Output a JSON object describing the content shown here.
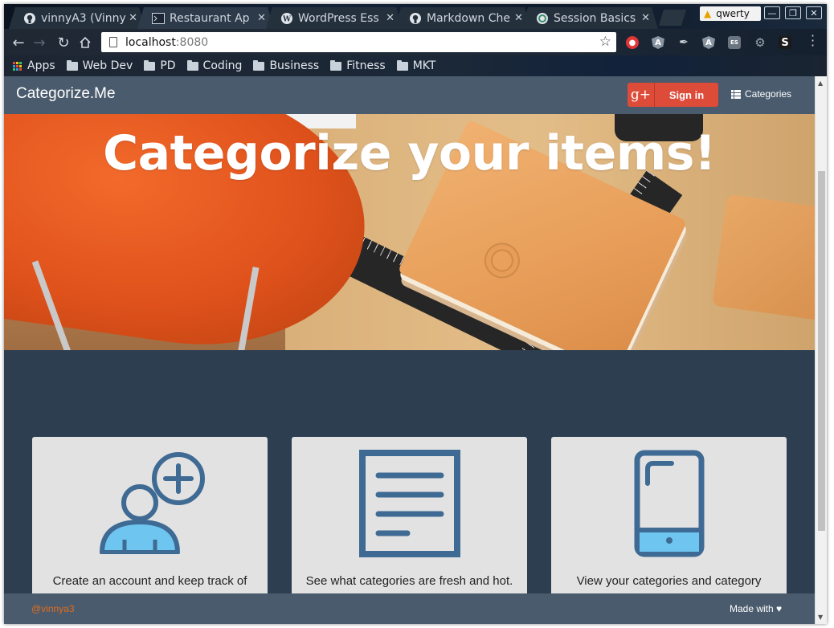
{
  "browser": {
    "tabs": [
      {
        "title": "vinnyA3 (Vinny",
        "icon": "github-icon"
      },
      {
        "title": "Restaurant Ap",
        "icon": "terminal-icon",
        "active": true
      },
      {
        "title": "WordPress Ess",
        "icon": "wordpress-icon"
      },
      {
        "title": "Markdown Che",
        "icon": "github-icon"
      },
      {
        "title": "Session Basics",
        "icon": "session-icon"
      }
    ],
    "profile_name": "qwerty",
    "url_host": "localhost",
    "url_port": ":8080",
    "bookmarks": {
      "apps": "Apps",
      "items": [
        "Web Dev",
        "PD",
        "Coding",
        "Business",
        "Fitness",
        "MKT"
      ]
    },
    "extensions": [
      "shield-ext-icon",
      "angular-ext-icon",
      "eyedropper-ext-icon",
      "angular-ext-icon",
      "es-ext-icon",
      "gear-ext-icon",
      "s-ext-icon"
    ],
    "extension_s_label": "S",
    "extension_es_label": "ES"
  },
  "site": {
    "brand": "Categorize.Me",
    "signin_label": "Sign in",
    "gplus_logo": "g+",
    "categories_label": "Categories",
    "hero_heading": "Categorize your items!",
    "cards": [
      {
        "icon": "add-user-icon",
        "text": "Create an account and keep track of"
      },
      {
        "icon": "document-icon",
        "text": "See what categories are fresh and hot."
      },
      {
        "icon": "mobile-phone-icon",
        "text": "View your categories and category"
      }
    ],
    "footer_handle": "@vinnya3",
    "footer_made": "Made with ♥"
  },
  "colors": {
    "nav_bg": "#4a5b6d",
    "page_bg": "#2c3e50",
    "gplus_red": "#dd4b39",
    "icon_blue": "#3e6a93",
    "icon_light": "#6ec6f0",
    "footer_handle": "#e06c1f"
  }
}
